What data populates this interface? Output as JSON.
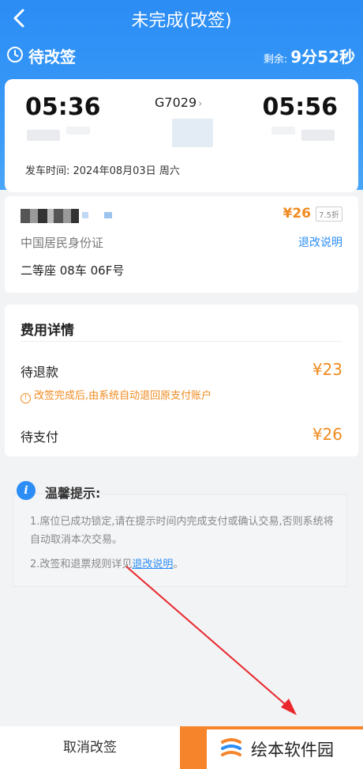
{
  "nav": {
    "title": "未完成(改签)",
    "back_icon": "back-chevron-icon"
  },
  "status": {
    "label": "待改签",
    "remaining_label": "剩余:",
    "remaining_time": "9分52秒",
    "icon": "clock-icon"
  },
  "ticket": {
    "depart_time": "05:36",
    "arrive_time": "05:56",
    "train_no": "G7029",
    "depart_date_text": "发车时间: 2024年08月03日 周六"
  },
  "passenger": {
    "price": "¥26",
    "discount": "7.5折",
    "id_type": "中国居民身份证",
    "refund_rule_link": "退改说明",
    "seat": "二等座 08车 06F号"
  },
  "fee": {
    "title": "费用详情",
    "refund_label": "待退款",
    "refund_amount": "¥23",
    "refund_note": "改签完成后,由系统自动退回原支付账户",
    "pay_label": "待支付",
    "pay_amount": "¥26"
  },
  "tips": {
    "title": "温馨提示:",
    "tip1": "1.席位已成功锁定,请在提示时间内完成支付或确认交易,否则系统将自动取消本次交易。",
    "tip2_prefix": "2.改签和退票规则详见",
    "tip2_link": "退改说明",
    "tip2_suffix": "。"
  },
  "bottom": {
    "cancel_label": "取消改签"
  },
  "watermark": {
    "text": "绘本软件园"
  },
  "colors": {
    "primary": "#2b8df5",
    "accent": "#f08a1e",
    "pay_button": "#f5842b",
    "arrow": "#e8262b"
  }
}
